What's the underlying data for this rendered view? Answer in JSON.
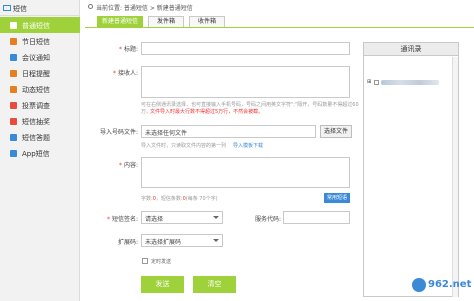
{
  "sidebar": {
    "title": "短信",
    "items": [
      {
        "label": "普通短信",
        "active": true,
        "icon": "message-icon",
        "color": "#ffffff"
      },
      {
        "label": "节日短信",
        "active": false,
        "icon": "calendar-icon",
        "color": "#e67e22"
      },
      {
        "label": "会议通知",
        "active": false,
        "icon": "meeting-icon",
        "color": "#3a8ad8"
      },
      {
        "label": "日程提醒",
        "active": false,
        "icon": "schedule-icon",
        "color": "#e67e22"
      },
      {
        "label": "动态短信",
        "active": false,
        "icon": "dynamic-icon",
        "color": "#e67e22"
      },
      {
        "label": "投票调查",
        "active": false,
        "icon": "vote-icon",
        "color": "#e74c3c"
      },
      {
        "label": "短信抽奖",
        "active": false,
        "icon": "lottery-icon",
        "color": "#e74c3c"
      },
      {
        "label": "短信答题",
        "active": false,
        "icon": "quiz-icon",
        "color": "#3a8ad8"
      },
      {
        "label": "App短信",
        "active": false,
        "icon": "app-icon",
        "color": "#3a8ad8"
      }
    ]
  },
  "breadcrumb": "当前位置: 普通短信 > 新建普通短信",
  "tabs": [
    {
      "label": "新建普通短信",
      "active": true
    },
    {
      "label": "发件箱",
      "active": false
    },
    {
      "label": "收件箱",
      "active": false
    }
  ],
  "form": {
    "title_label": "标题:",
    "recipient_label": "接收人:",
    "recipient_hint_1": "可在右侧通讯录选择，也可直接输入手机号码，号码之间用英文字符\";\"隔开，号码数量不得超过60",
    "recipient_hint_2": "万。",
    "recipient_warn": "文件导入时最大行数不得超过5万行，不然会被截。",
    "import_label": "导入号码文件:",
    "import_placeholder": "未选择任何文件",
    "import_button": "选择文件",
    "import_hint": "导入文件时，只读取文件内容的第一列",
    "import_link": "导入模板下载",
    "content_label": "内容:",
    "count_text": "字数:",
    "count_value": "0",
    "count_mid": "，短信条数:",
    "count_value2": "0",
    "count_tail": "(每条 70个字)",
    "common_phrase_button": "常用短语",
    "signature_label": "短信签名:",
    "signature_select": "请选择",
    "service_label": "服务代码:",
    "ext_label": "扩展码:",
    "ext_select": "未选择扩展码",
    "timed_label": "定时发送",
    "send_button": "发送",
    "clear_button": "清空"
  },
  "contacts": {
    "title": "通讯录"
  },
  "watermark": "962.net"
}
